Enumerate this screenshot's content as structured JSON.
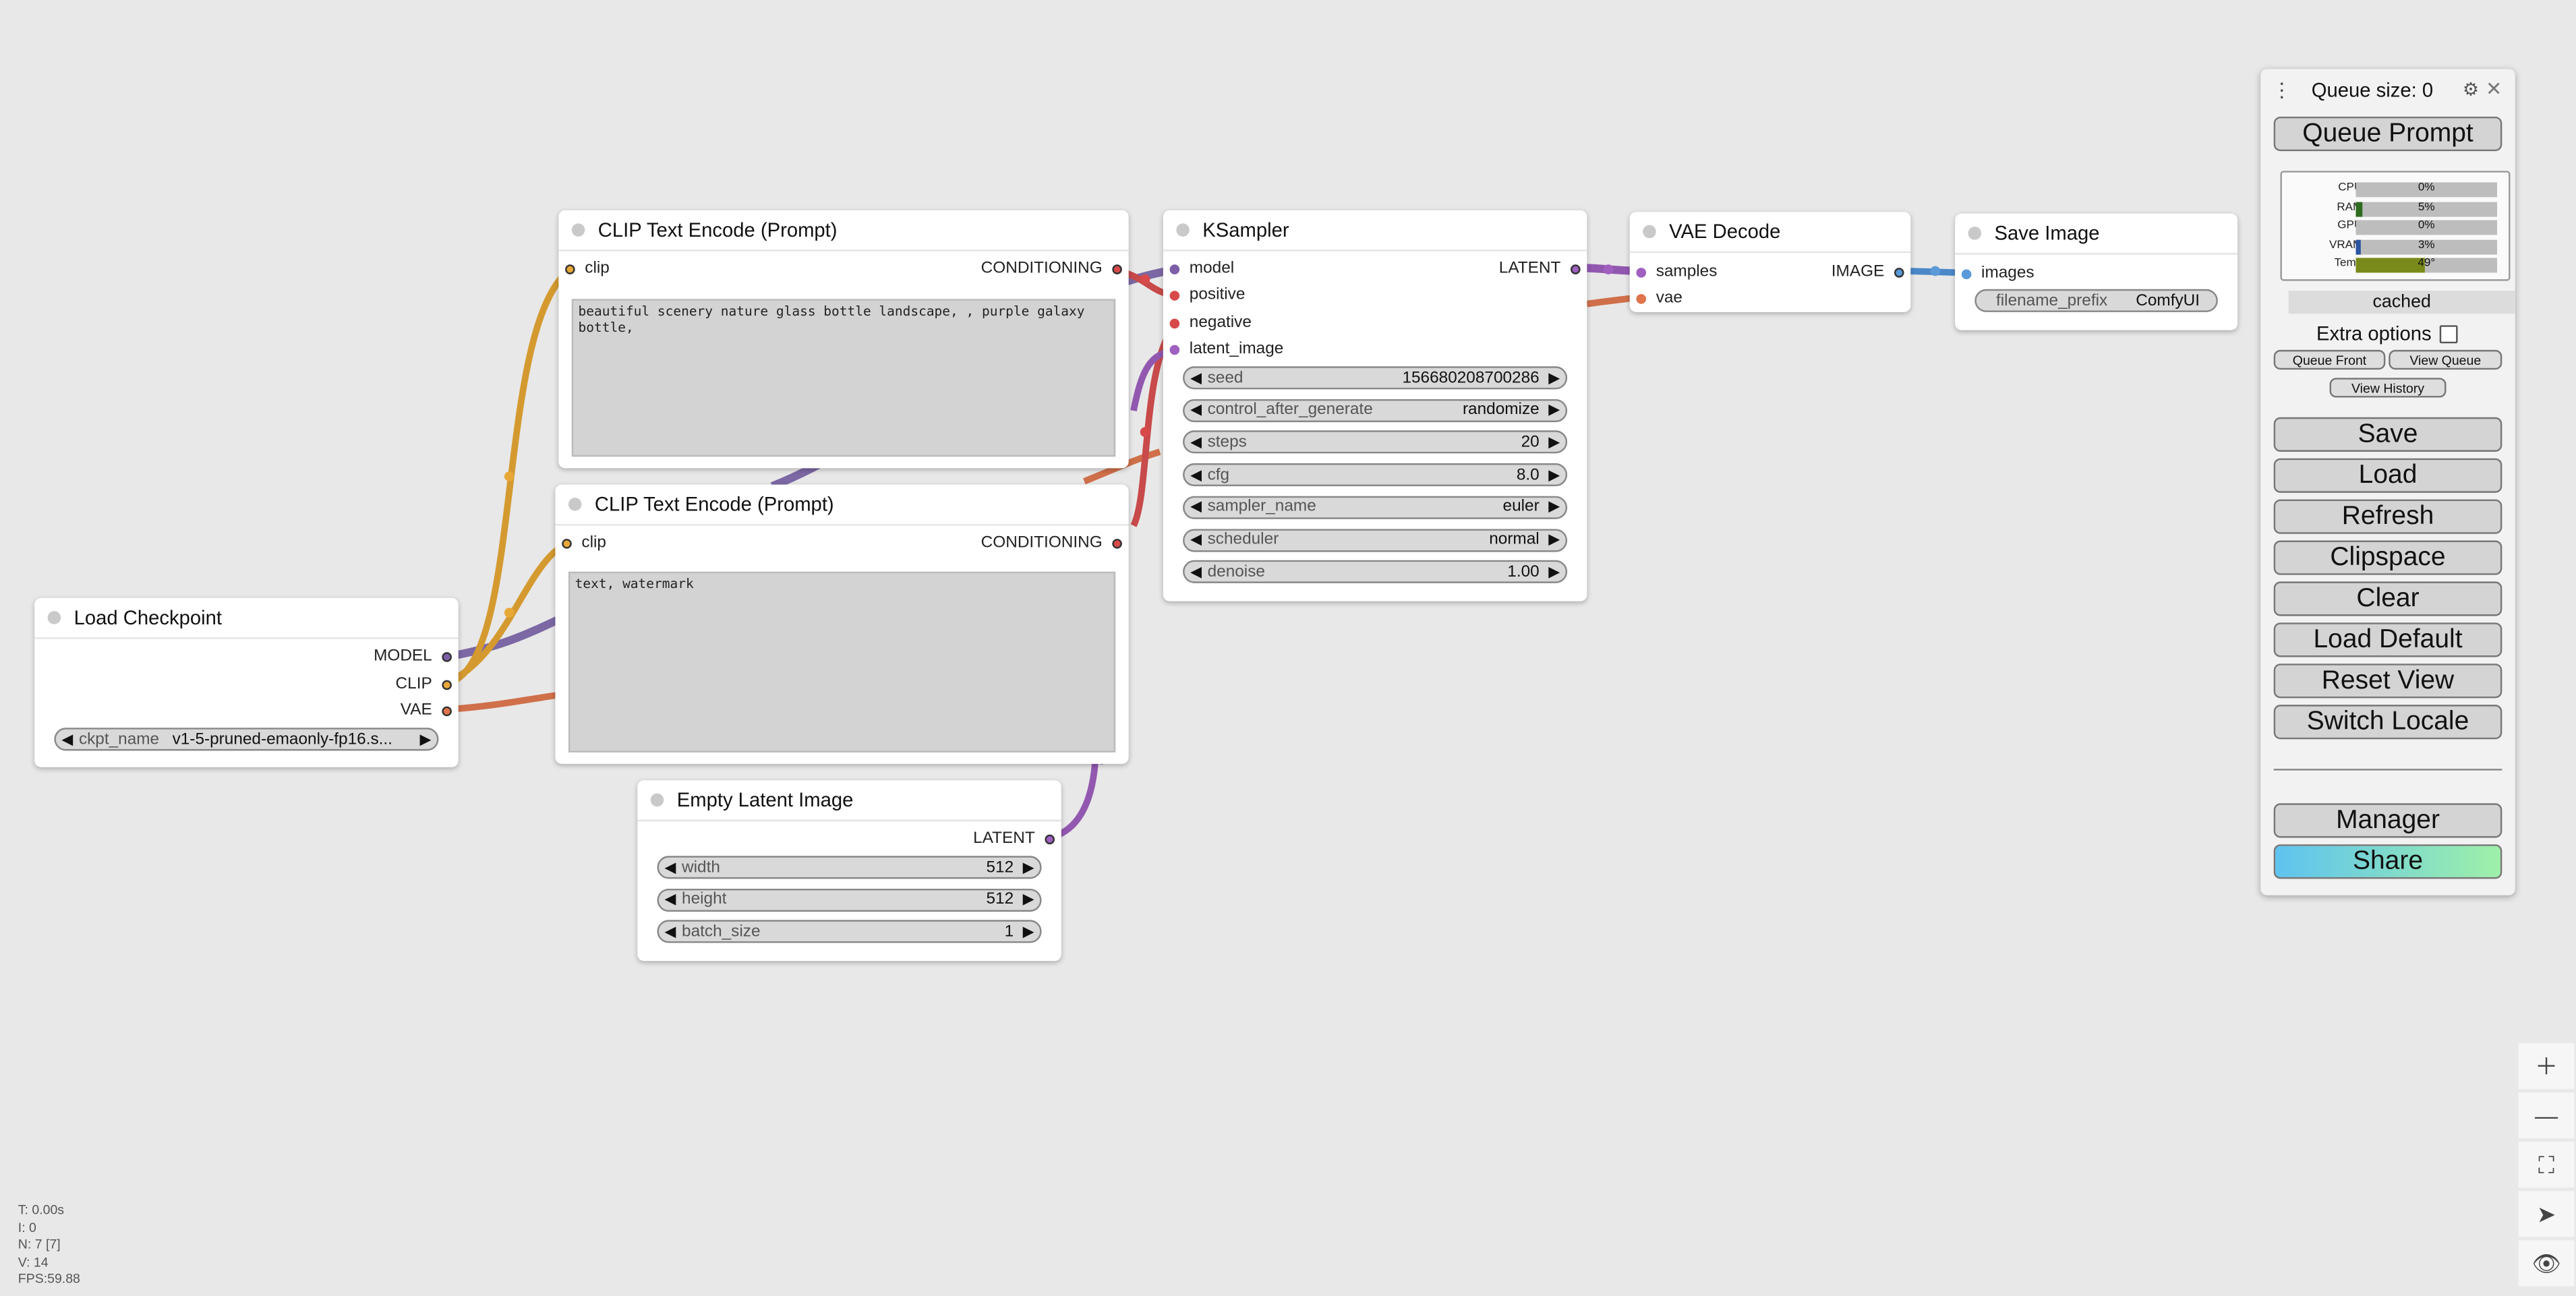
{
  "nodes": {
    "clip_pos": {
      "title": "CLIP Text Encode (Prompt)",
      "input_clip": "clip",
      "output": "CONDITIONING",
      "text": "beautiful scenery nature glass bottle landscape, , purple galaxy bottle,"
    },
    "clip_neg": {
      "title": "CLIP Text Encode (Prompt)",
      "input_clip": "clip",
      "output": "CONDITIONING",
      "text": "text, watermark"
    },
    "load_checkpoint": {
      "title": "Load Checkpoint",
      "out_model": "MODEL",
      "out_clip": "CLIP",
      "out_vae": "VAE",
      "ckpt_label": "ckpt_name",
      "ckpt_value": "v1-5-pruned-emaonly-fp16.s..."
    },
    "ksampler": {
      "title": "KSampler",
      "in_model": "model",
      "in_positive": "positive",
      "in_negative": "negative",
      "in_latent": "latent_image",
      "output": "LATENT",
      "widgets": [
        {
          "name": "seed",
          "value": "156680208700286"
        },
        {
          "name": "control_after_generate",
          "value": "randomize"
        },
        {
          "name": "steps",
          "value": "20"
        },
        {
          "name": "cfg",
          "value": "8.0"
        },
        {
          "name": "sampler_name",
          "value": "euler"
        },
        {
          "name": "scheduler",
          "value": "normal"
        },
        {
          "name": "denoise",
          "value": "1.00"
        }
      ]
    },
    "vae_decode": {
      "title": "VAE Decode",
      "in_samples": "samples",
      "in_vae": "vae",
      "output": "IMAGE"
    },
    "save_image": {
      "title": "Save Image",
      "in_images": "images",
      "prefix_label": "filename_prefix",
      "prefix_value": "ComfyUI"
    },
    "empty_latent": {
      "title": "Empty Latent Image",
      "output": "LATENT",
      "widgets": [
        {
          "name": "width",
          "value": "512"
        },
        {
          "name": "height",
          "value": "512"
        },
        {
          "name": "batch_size",
          "value": "1"
        }
      ]
    }
  },
  "menu": {
    "queue_size": "Queue size: 0",
    "queue_prompt": "Queue Prompt",
    "monitor": [
      {
        "label": "CPU",
        "value": "0%",
        "fraction": 0.0,
        "color": "#3a7a2a"
      },
      {
        "label": "RAM",
        "value": "5%",
        "fraction": 0.05,
        "color": "#2e6b1e"
      },
      {
        "label": "GPU",
        "value": "0%",
        "fraction": 0.0,
        "color": "#3a7a2a"
      },
      {
        "label": "VRAM",
        "value": "3%",
        "fraction": 0.03,
        "color": "#2a55a0"
      },
      {
        "label": "Temp",
        "value": "49°",
        "fraction": 0.49,
        "color": "#7a8a1a"
      }
    ],
    "cached": "cached",
    "extra_options": "Extra options",
    "queue_front": "Queue Front",
    "view_queue": "View Queue",
    "view_history": "View History",
    "buttons": [
      "Save",
      "Load",
      "Refresh",
      "Clipspace",
      "Clear",
      "Load Default",
      "Reset View",
      "Switch Locale"
    ],
    "manager": "Manager",
    "share": "Share"
  },
  "stats": {
    "t": "T: 0.00s",
    "i": "I: 0",
    "n": "N: 7 [7]",
    "v": "V: 14",
    "fps": "FPS:59.88"
  },
  "colors": {
    "model": "#7d5fa8",
    "clip": "#e8a838",
    "vae": "#e0744a",
    "conditioning": "#d84a4a",
    "latent": "#a060c0",
    "image": "#5a9ad8",
    "canvas": "#e8e8e8"
  }
}
